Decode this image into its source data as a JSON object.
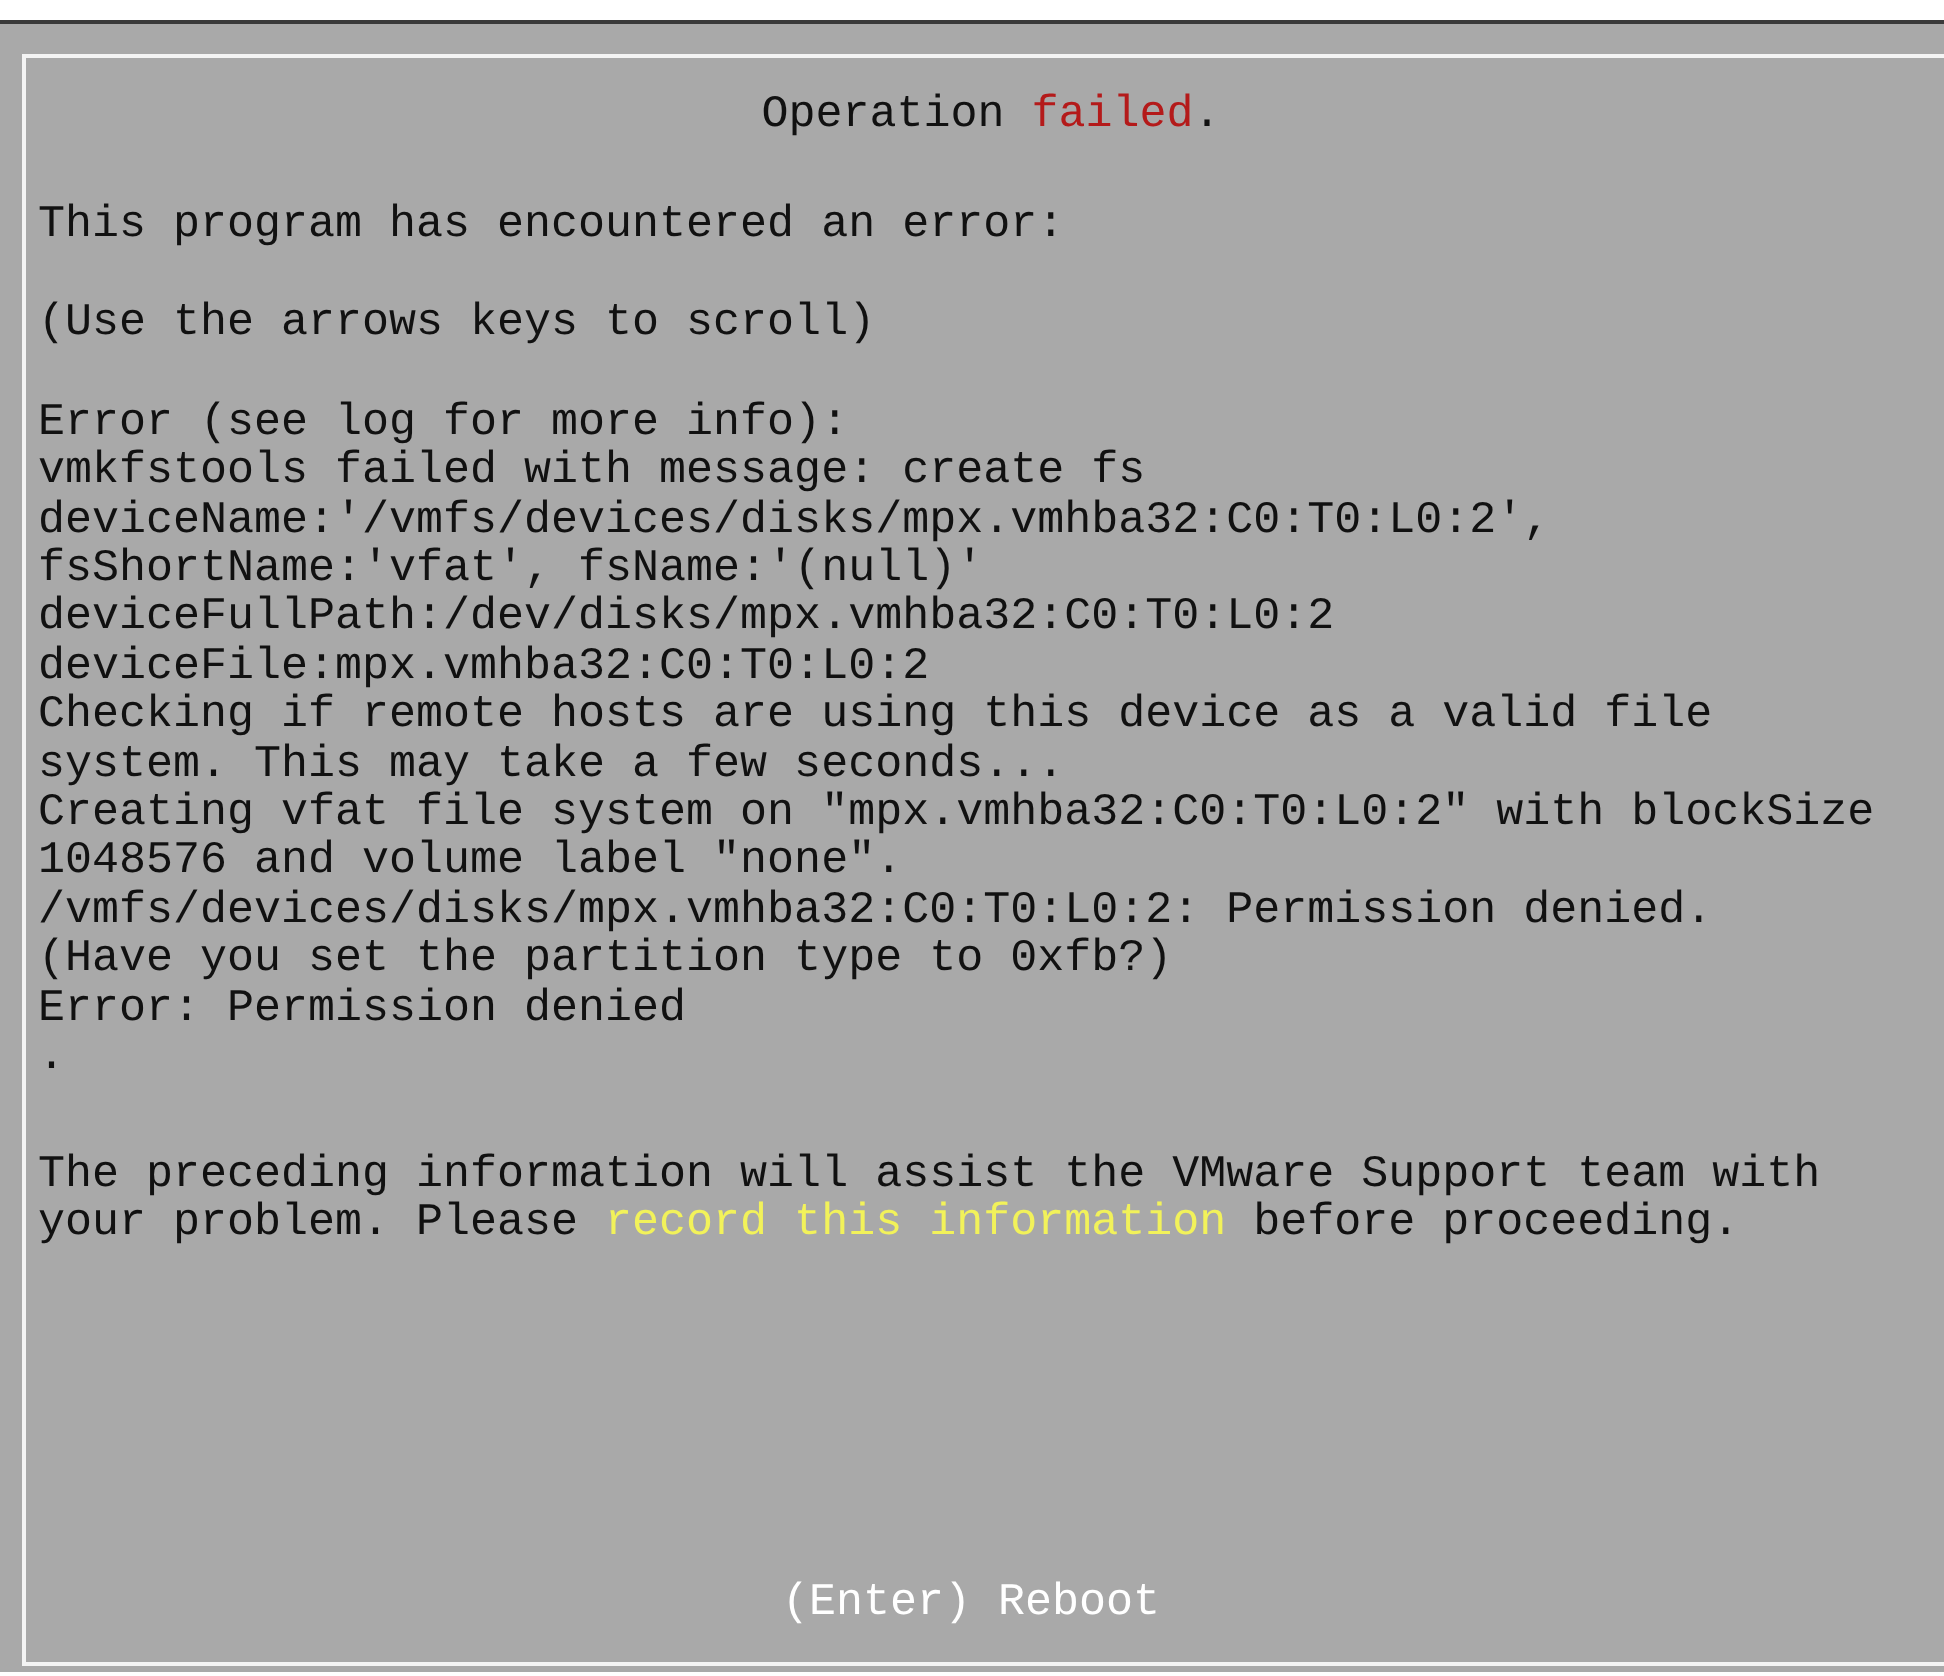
{
  "title": [
    {
      "text": "Operation ",
      "kind": "plain"
    },
    {
      "text": "failed",
      "kind": "alert"
    },
    {
      "text": ".",
      "kind": "plain"
    }
  ],
  "intro": "This program has encountered an error:",
  "hint": "(Use the arrows keys to scroll)",
  "error_lines": [
    "Error (see log for more info):",
    "vmkfstools failed with message: create fs",
    "deviceName:'/vmfs/devices/disks/mpx.vmhba32:C0:T0:L0:2',",
    "fsShortName:'vfat', fsName:'(null)'",
    "deviceFullPath:/dev/disks/mpx.vmhba32:C0:T0:L0:2",
    "deviceFile:mpx.vmhba32:C0:T0:L0:2",
    "Checking if remote hosts are using this device as a valid file",
    "system. This may take a few seconds...",
    "Creating vfat file system on \"mpx.vmhba32:C0:T0:L0:2\" with blockSize",
    "1048576 and volume label \"none\".",
    "/vmfs/devices/disks/mpx.vmhba32:C0:T0:L0:2: Permission denied.",
    "(Have you set the partition type to 0xfb?)",
    "Error: Permission denied",
    "."
  ],
  "footer": [
    {
      "text": "The preceding information will assist the VMware Support team with your problem. Please ",
      "kind": "plain"
    },
    {
      "text": "record this information",
      "kind": "highlight"
    },
    {
      "text": " before proceeding.",
      "kind": "plain"
    }
  ],
  "action": "(Enter) Reboot"
}
